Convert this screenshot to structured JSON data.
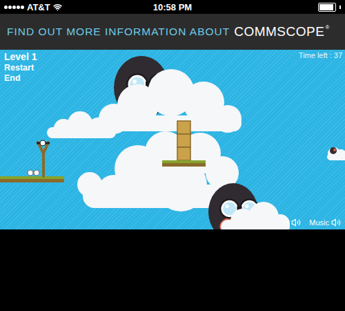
{
  "status_bar": {
    "carrier": "AT&T",
    "time": "10:58 PM",
    "signal_level": 1,
    "battery_level": 0.9
  },
  "banner": {
    "text": "FIND OUT MORE INFORMATION ABOUT",
    "brand": "COMMSCOPE",
    "mark": "®"
  },
  "game": {
    "level": "Level 1",
    "menu": [
      "Restart",
      "End"
    ],
    "timer": "Time left : 37",
    "sound_controls": [
      {
        "label": "ct",
        "on": true
      },
      {
        "label": "Music",
        "on": true
      }
    ]
  }
}
